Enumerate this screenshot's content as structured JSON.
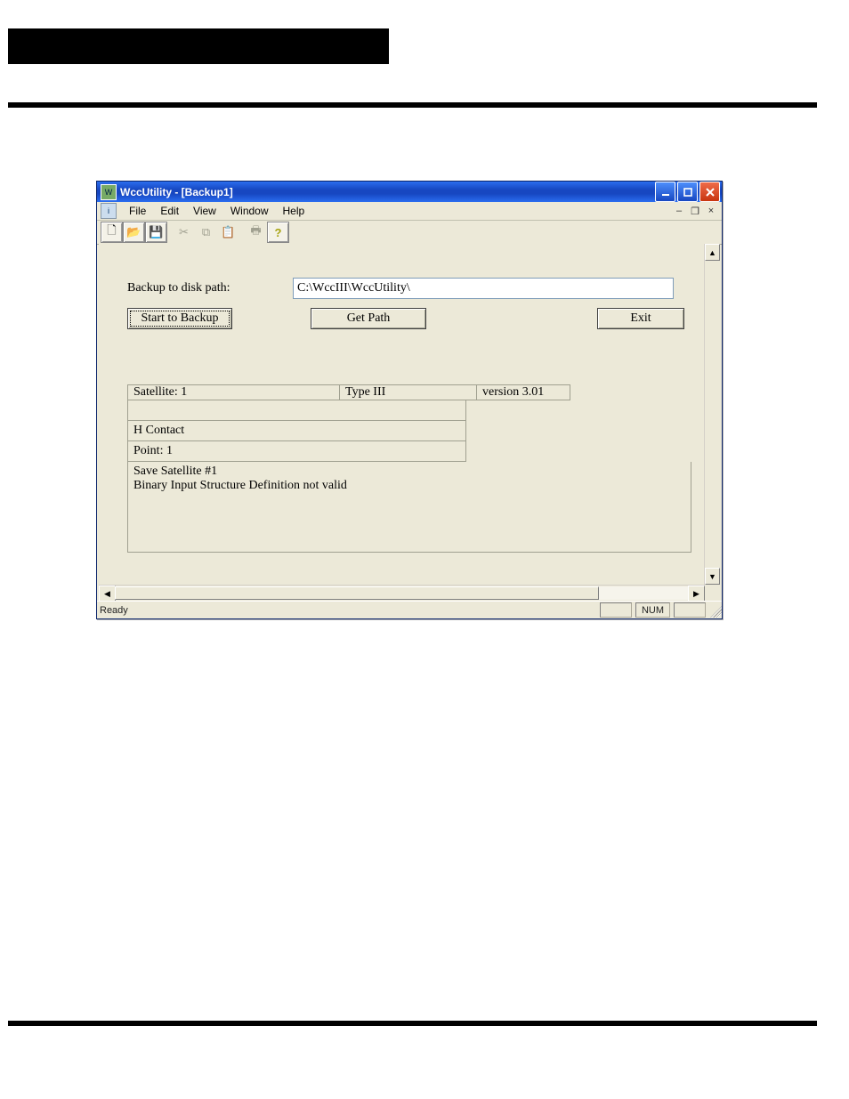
{
  "window": {
    "title": "WccUtility - [Backup1]"
  },
  "menubar": {
    "file": "File",
    "edit": "Edit",
    "view": "View",
    "window": "Window",
    "help": "Help"
  },
  "form": {
    "backup_path_label": "Backup to disk path:",
    "backup_path_value": "C:\\WccIII\\WccUtility\\",
    "start_backup": "Start to Backup",
    "get_path": "Get Path",
    "exit": "Exit",
    "satellite_label": "Satellite: 1",
    "type_label": "Type III",
    "version_label": "version 3.01",
    "hcontact": "H Contact",
    "point": "Point: 1",
    "log": "Save Satellite #1\nBinary Input Structure Definition not valid"
  },
  "statusbar": {
    "ready": "Ready",
    "num": "NUM"
  },
  "icons": {
    "new": "🗋",
    "open": "📂",
    "save": "💾",
    "cut": "✂",
    "copy": "⧉",
    "paste": "📋",
    "print": "🖶",
    "help": "?"
  }
}
